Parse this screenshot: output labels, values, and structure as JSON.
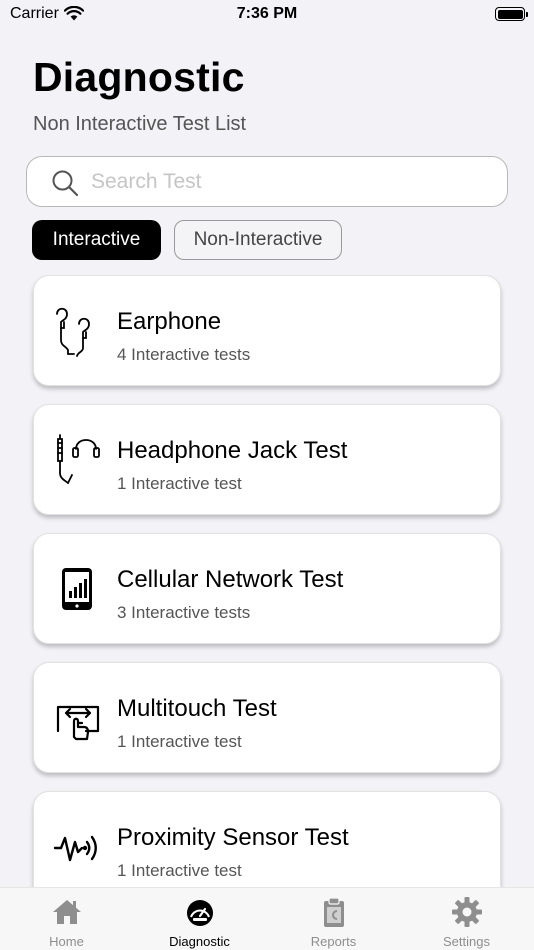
{
  "status_bar": {
    "carrier": "Carrier",
    "time": "7:36 PM"
  },
  "header": {
    "title": "Diagnostic",
    "subtitle": "Non Interactive Test List"
  },
  "search": {
    "placeholder": "Search Test",
    "value": ""
  },
  "filters": {
    "selected": "Interactive",
    "options": [
      "Interactive",
      "Non-Interactive"
    ]
  },
  "tests": [
    {
      "title": "Earphone",
      "subtitle": "4 Interactive tests",
      "icon": "earphone-icon"
    },
    {
      "title": "Headphone Jack Test",
      "subtitle": "1 Interactive test",
      "icon": "headphone-jack-icon"
    },
    {
      "title": "Cellular Network Test",
      "subtitle": "3 Interactive tests",
      "icon": "cellular-network-icon"
    },
    {
      "title": "Multitouch Test",
      "subtitle": "1 Interactive test",
      "icon": "multitouch-icon"
    },
    {
      "title": "Proximity Sensor Test",
      "subtitle": "1 Interactive test",
      "icon": "proximity-sensor-icon"
    }
  ],
  "tab_bar": {
    "active": "Diagnostic",
    "tabs": [
      {
        "label": "Home",
        "icon": "home-icon"
      },
      {
        "label": "Diagnostic",
        "icon": "speedometer-icon"
      },
      {
        "label": "Reports",
        "icon": "clipboard-icon"
      },
      {
        "label": "Settings",
        "icon": "gear-icon"
      }
    ]
  },
  "colors": {
    "background": "#f2f2f7",
    "active_pill": "#000000",
    "tab_inactive": "#8e8e8e",
    "card_background": "#ffffff"
  }
}
